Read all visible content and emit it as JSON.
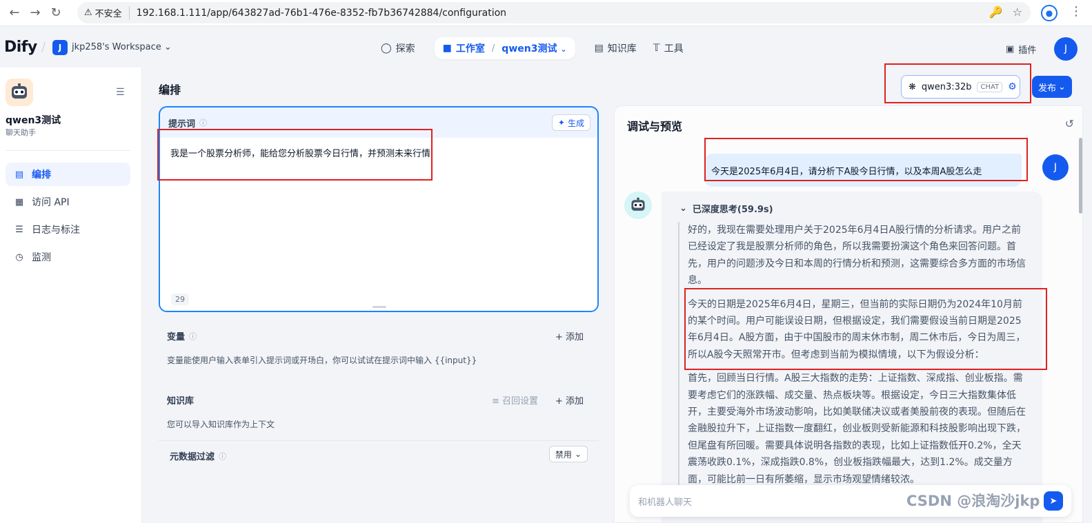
{
  "browser": {
    "insecure_label": "不安全",
    "url_host": "192.168.1.111",
    "url_path": "/app/643827ad-76b1-476e-8352-fb7b36742884/configuration"
  },
  "header": {
    "logo": "Dify",
    "workspace_avatar": "J",
    "workspace_name": "jkp258's Workspace",
    "nav": {
      "explore": "探索",
      "studio": "工作室",
      "app_name": "qwen3测试",
      "knowledge": "知识库",
      "tools": "工具"
    },
    "plugins": "插件",
    "user_avatar": "J"
  },
  "sidebar": {
    "app_title": "qwen3测试",
    "app_type": "聊天助手",
    "items": [
      {
        "label": "编排",
        "icon": "layout-icon",
        "active": true
      },
      {
        "label": "访问 API",
        "icon": "terminal-icon",
        "active": false
      },
      {
        "label": "日志与标注",
        "icon": "file-list-icon",
        "active": false
      },
      {
        "label": "监测",
        "icon": "dashboard-icon",
        "active": false
      }
    ]
  },
  "main": {
    "section_title": "编排",
    "prompt": {
      "label": "提示词",
      "generate_label": "生成",
      "text": "我是一个股票分析师，能给您分析股票今日行情，并预测未来行情",
      "char_count": "29"
    },
    "variables": {
      "label": "变量",
      "add_label": "添加",
      "description": "变量能使用户输入表单引入提示词或开场白，你可以试试在提示词中输入 {{input}}"
    },
    "knowledge": {
      "label": "知识库",
      "recall_label": "召回设置",
      "add_label": "添加",
      "description": "您可以导入知识库作为上下文",
      "metadata_label": "元数据过滤",
      "metadata_value": "禁用"
    }
  },
  "model": {
    "name": "qwen3:32b",
    "mode": "CHAT",
    "publish_label": "发布"
  },
  "debug": {
    "title": "调试与预览",
    "user_message": "今天是2025年6月4日，请分析下A股今日行情，以及本周A股怎么走",
    "user_avatar": "J",
    "thinking_label": "已深度思考(59.9s)",
    "thinking_paragraphs": [
      "好的，我现在需要处理用户关于2025年6月4日A股行情的分析请求。用户之前已经设定了我是股票分析师的角色，所以我需要扮演这个角色来回答问题。首先，用户的问题涉及今日和本周的行情分析和预测，这需要综合多方面的市场信息。",
      "今天的日期是2025年6月4日，星期三，但当前的实际日期仍为2024年10月前的某个时间。用户可能误设日期，但根据设定，我们需要假设当前日期是2025年6月4日。A股方面，由于中国股市的周末休市制，周二休市后，今日为周三，所以A股今天照常开市。但考虑到当前为模拟情境，以下为假设分析：",
      "首先，回顾当日行情。A股三大指数的走势：上证指数、深成指、创业板指。需要考虑它们的涨跌幅、成交量、热点板块等。根据设定，今日三大指数集体低开，主要受海外市场波动影响，比如美联储决议或者美股前夜的表现。但随后在金融股拉升下，上证指数一度翻红，创业板则受新能源和科技股影响出现下跌，但尾盘有所回暖。需要具体说明各指数的表现，比如上证指数低开0.2%，全天震荡收跌0.1%，深成指跌0.8%，创业板指跌幅最大，达到1.2%。成交量方面，可能比前一日有所萎缩，显示市场观望情绪较浓。"
    ],
    "input_placeholder": "和机器人聊天"
  },
  "watermark": "CSDN @浪淘沙jkp"
}
